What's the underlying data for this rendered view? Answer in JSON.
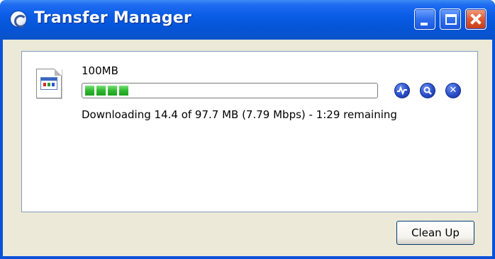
{
  "window": {
    "title": "Transfer Manager",
    "controls": [
      "minimize-icon",
      "maximize-icon",
      "close-icon"
    ]
  },
  "transfer": {
    "file_name": "100MB",
    "progress_fraction": 0.147,
    "status": "Downloading 14.4 of 97.7 MB (7.79 Mbps) - 1:29 remaining",
    "actions": [
      "activity-icon",
      "search-icon",
      "cancel-icon"
    ]
  },
  "footer": {
    "cleanup_label": "Clean Up"
  },
  "colors": {
    "titlebar": "#0a5ce6",
    "progress": "#2fb82f",
    "action_button": "#2a4ec8",
    "client_bg": "#ece9d8"
  }
}
